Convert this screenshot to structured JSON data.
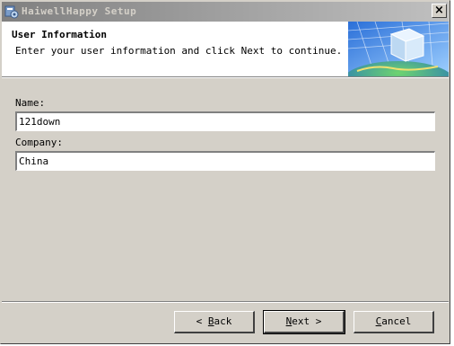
{
  "window": {
    "title": "HaiwellHappy Setup",
    "close_label": "×"
  },
  "header": {
    "title": "User Information",
    "description": "Enter your user information and click Next to continue."
  },
  "form": {
    "name_label": "Name:",
    "name_value": "121down",
    "company_label": "Company:",
    "company_value": "China"
  },
  "buttons": {
    "back": {
      "mnemonic": "B",
      "rest": "ack",
      "suffix": " <"
    },
    "next": {
      "mnemonic": "N",
      "rest": "ext",
      "suffix": " >"
    },
    "cancel": {
      "mnemonic": "C",
      "rest": "ancel"
    }
  },
  "colors": {
    "face": "#d4d0c8",
    "titlebar_start": "#808080",
    "titlebar_end": "#c0c0c0",
    "header_bg": "#ffffff"
  }
}
